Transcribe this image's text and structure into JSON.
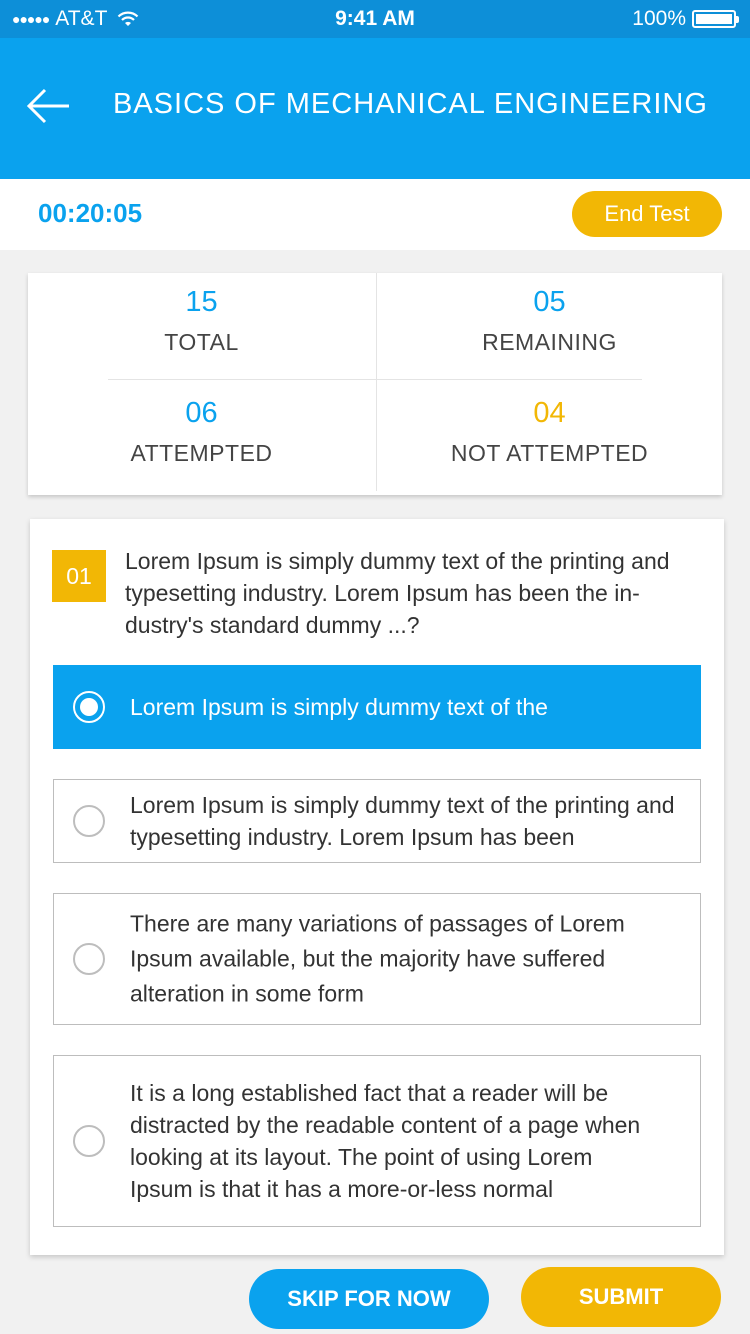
{
  "status_bar": {
    "carrier": "AT&T",
    "signal_icon": "signal-dots-icon",
    "wifi_icon": "wifi-icon",
    "time": "9:41 AM",
    "battery": "100%",
    "battery_icon": "battery-icon"
  },
  "header": {
    "back_icon": "back-arrow-icon",
    "title": "BASICS OF MECHANICAL ENGINEERING"
  },
  "timer_bar": {
    "timer": "00:20:05",
    "end_test_label": "End Test"
  },
  "stats": {
    "total": {
      "value": "15",
      "label": "TOTAL"
    },
    "remaining": {
      "value": "05",
      "label": "REMAINING"
    },
    "attempted": {
      "value": "06",
      "label": "ATTEMPTED"
    },
    "not_attempted": {
      "value": "04",
      "label": "NOT ATTEMPTED"
    }
  },
  "question": {
    "number": "01",
    "text": "Lorem Ipsum is simply dummy text of the printing and typesetting industry. Lorem Ipsum has been the in-dustry's standard dummy ...?",
    "options": [
      {
        "text": "Lorem Ipsum is simply dummy text of the",
        "selected": true
      },
      {
        "text": "Lorem Ipsum is simply dummy text of the printing and typesetting industry. Lorem Ipsum has been",
        "selected": false
      },
      {
        "text": "There are many variations of passages of Lorem Ipsum available, but the majority have suffered alteration in some form",
        "selected": false
      },
      {
        "text": "It is a long established fact that a reader will be distracted by the readable content of a page when looking at its layout. The point of using Lorem Ipsum is that it has a more-or-less normal",
        "selected": false
      }
    ]
  },
  "footer": {
    "skip_label": "SKIP FOR NOW",
    "submit_label": "SUBMIT"
  },
  "colors": {
    "primary_blue": "#0aa2ee",
    "status_bar_blue": "#0d8fd8",
    "accent_yellow": "#f2b705"
  }
}
